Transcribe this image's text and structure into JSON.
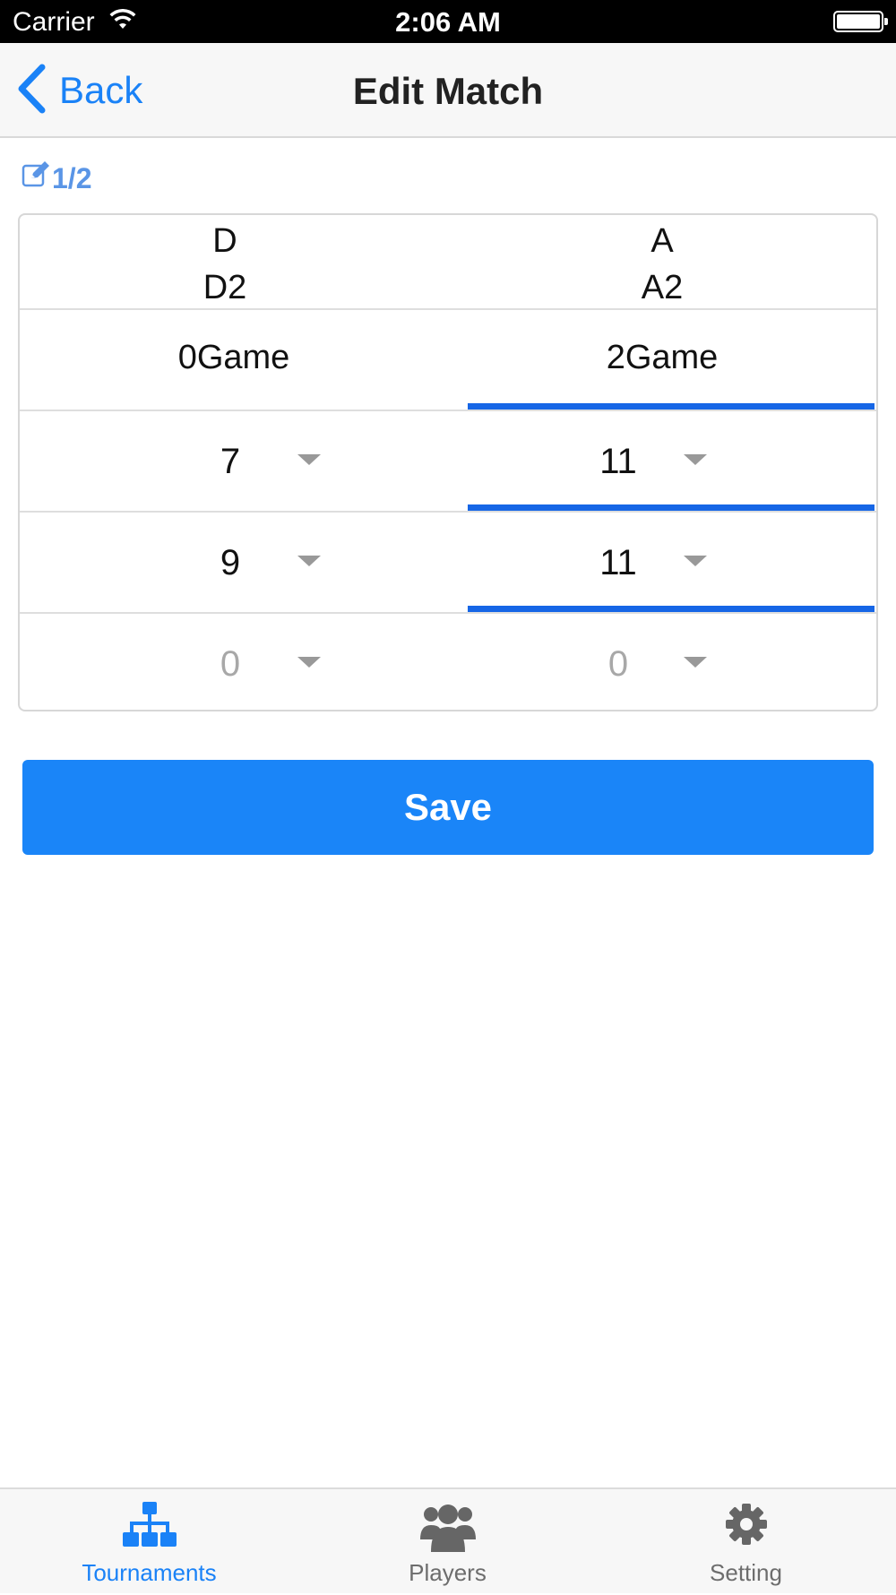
{
  "status_bar": {
    "carrier": "Carrier",
    "time": "2:06 AM"
  },
  "nav": {
    "back_label": "Back",
    "title": "Edit Match"
  },
  "match": {
    "index_label": "1/2"
  },
  "teams": {
    "left": {
      "line1": "D",
      "line2": "D2",
      "games": "0Game",
      "winner": false
    },
    "right": {
      "line1": "A",
      "line2": "A2",
      "games": "2Game",
      "winner": true
    }
  },
  "sets": [
    {
      "left": "7",
      "right": "11",
      "right_wins": true,
      "empty": false
    },
    {
      "left": "9",
      "right": "11",
      "right_wins": true,
      "empty": false
    },
    {
      "left": "0",
      "right": "0",
      "right_wins": false,
      "empty": true
    }
  ],
  "save_label": "Save",
  "tabs": [
    {
      "label": "Tournaments",
      "icon": "hierarchy-icon",
      "active": true
    },
    {
      "label": "Players",
      "icon": "people-icon",
      "active": false
    },
    {
      "label": "Setting",
      "icon": "gear-icon",
      "active": false
    }
  ],
  "colors": {
    "accent": "#1a82f7",
    "winner_bar": "#1666e6",
    "save_button": "#1a85f8",
    "muted": "#a8a8a8"
  }
}
